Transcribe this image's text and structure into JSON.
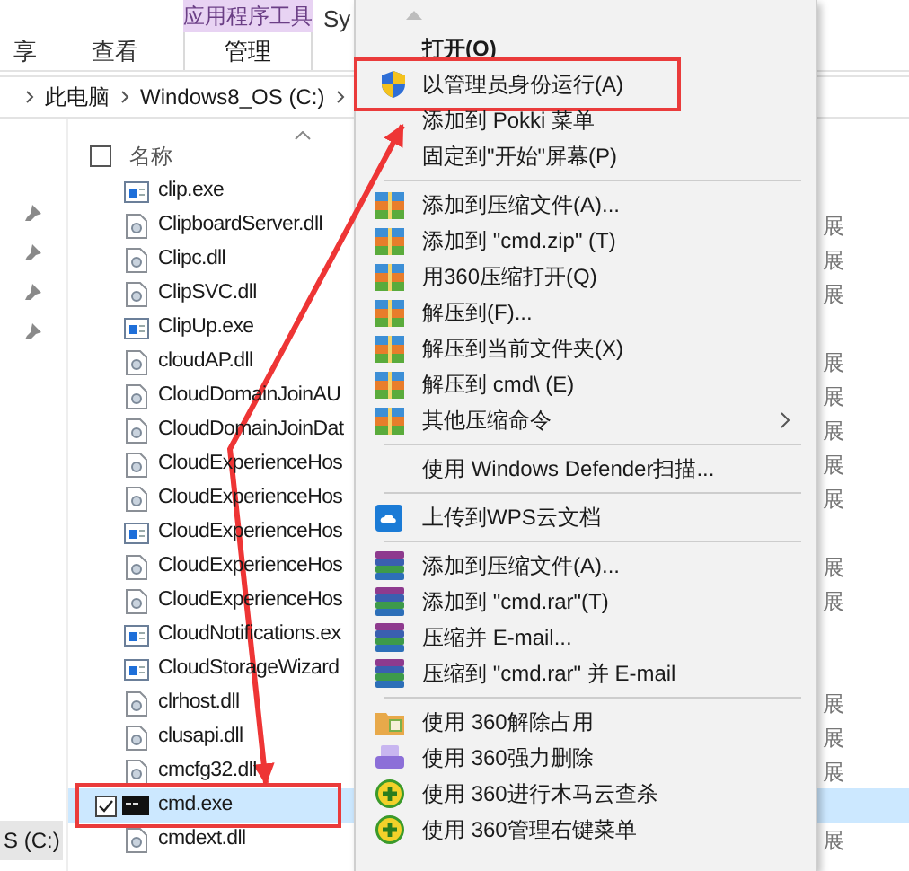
{
  "ribbon": {
    "context_header": "应用程序工具",
    "tabs": [
      {
        "label": "享",
        "selected": false
      },
      {
        "label": "查看",
        "selected": false
      },
      {
        "label": "管理",
        "selected": true
      }
    ],
    "cut_tab": "Sy"
  },
  "address_bar": {
    "segments": [
      "此电脑",
      "Windows8_OS (C:)"
    ]
  },
  "nav_pane": {
    "drive": "S (C:)"
  },
  "file_list": {
    "header": "名称",
    "select_all": {
      "checked": false
    },
    "rows": [
      {
        "name": "clip.exe",
        "kind": "exe",
        "selected": false
      },
      {
        "name": "ClipboardServer.dll",
        "kind": "dll",
        "selected": false,
        "column_2": "展"
      },
      {
        "name": "Clipc.dll",
        "kind": "dll",
        "selected": false,
        "column_2": "展"
      },
      {
        "name": "ClipSVC.dll",
        "kind": "dll",
        "selected": false,
        "column_2": "展"
      },
      {
        "name": "ClipUp.exe",
        "kind": "exe",
        "selected": false
      },
      {
        "name": "cloudAP.dll",
        "kind": "dll",
        "selected": false,
        "column_2": "展"
      },
      {
        "name": "CloudDomainJoinAU",
        "kind": "dll",
        "selected": false,
        "column_2": "展"
      },
      {
        "name": "CloudDomainJoinDat",
        "kind": "dll",
        "selected": false,
        "column_2": "展"
      },
      {
        "name": "CloudExperienceHos",
        "kind": "dll",
        "selected": false,
        "column_2": "展"
      },
      {
        "name": "CloudExperienceHos",
        "kind": "dll",
        "selected": false,
        "column_2": "展"
      },
      {
        "name": "CloudExperienceHos",
        "kind": "exe",
        "selected": false
      },
      {
        "name": "CloudExperienceHos",
        "kind": "dll",
        "selected": false,
        "column_2": "展"
      },
      {
        "name": "CloudExperienceHos",
        "kind": "dll",
        "selected": false,
        "column_2": "展"
      },
      {
        "name": "CloudNotifications.ex",
        "kind": "exe",
        "selected": false
      },
      {
        "name": "CloudStorageWizard",
        "kind": "exe",
        "selected": false
      },
      {
        "name": "clrhost.dll",
        "kind": "dll",
        "selected": false,
        "column_2": "展"
      },
      {
        "name": "clusapi.dll",
        "kind": "dll",
        "selected": false,
        "column_2": "展"
      },
      {
        "name": "cmcfg32.dll",
        "kind": "dll",
        "selected": false,
        "column_2": "展"
      },
      {
        "name": "cmd.exe",
        "kind": "console",
        "selected": true,
        "boxed": true
      },
      {
        "name": "cmdext.dll",
        "kind": "dll",
        "selected": false,
        "column_2": "展"
      }
    ]
  },
  "context_menu": {
    "items": [
      {
        "kind": "text",
        "label": "打开(O)",
        "bold": true
      },
      {
        "kind": "shield",
        "label": "以管理员身份运行(A)",
        "boxed": true
      },
      {
        "kind": "text",
        "label": "添加到 Pokki 菜单"
      },
      {
        "kind": "text",
        "label": "固定到\"开始\"屏幕(P)"
      },
      {
        "kind": "separator"
      },
      {
        "kind": "archive",
        "label": "添加到压缩文件(A)..."
      },
      {
        "kind": "archive",
        "label": "添加到 \"cmd.zip\" (T)"
      },
      {
        "kind": "archive",
        "label": "用360压缩打开(Q)"
      },
      {
        "kind": "archive",
        "label": "解压到(F)..."
      },
      {
        "kind": "archive",
        "label": "解压到当前文件夹(X)"
      },
      {
        "kind": "archive",
        "label": "解压到 cmd\\ (E)"
      },
      {
        "kind": "archive",
        "label": "其他压缩命令",
        "submenu": true
      },
      {
        "kind": "separator"
      },
      {
        "kind": "text",
        "label": "使用 Windows Defender扫描..."
      },
      {
        "kind": "separator"
      },
      {
        "kind": "cloud",
        "label": "上传到WPS云文档"
      },
      {
        "kind": "separator"
      },
      {
        "kind": "books",
        "label": "添加到压缩文件(A)..."
      },
      {
        "kind": "books",
        "label": "添加到 \"cmd.rar\"(T)"
      },
      {
        "kind": "books",
        "label": "压缩并 E-mail..."
      },
      {
        "kind": "books",
        "label": "压缩到 \"cmd.rar\" 并 E-mail"
      },
      {
        "kind": "separator"
      },
      {
        "kind": "folder",
        "label": "使用 360解除占用"
      },
      {
        "kind": "shredder",
        "label": "使用 360强力删除"
      },
      {
        "kind": "plus",
        "label": "使用 360进行木马云查杀"
      },
      {
        "kind": "plus",
        "label": "使用 360管理右键菜单"
      }
    ]
  }
}
